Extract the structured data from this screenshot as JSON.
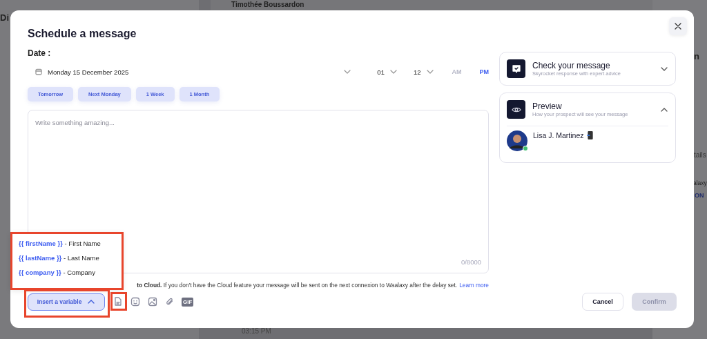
{
  "backdrop": {
    "texts": [
      {
        "kind": "heading",
        "text": "Di"
      },
      {
        "kind": "contact",
        "text": "Timothée Boussardon"
      },
      {
        "kind": "side-name",
        "text": "n"
      },
      {
        "kind": "details",
        "text": "tails"
      },
      {
        "kind": "brand",
        "text": "alaxy"
      },
      {
        "kind": "badge",
        "text": "ON"
      },
      {
        "kind": "time",
        "text": "03:15 PM"
      }
    ]
  },
  "modal": {
    "title": "Schedule a message",
    "date_label": "Date :",
    "date": {
      "value": "Monday 15 December 2025",
      "hour": "01",
      "minute": "12",
      "periods": [
        {
          "label": "AM",
          "selected": false
        },
        {
          "label": "PM",
          "selected": true
        }
      ]
    },
    "quick_dates": [
      "Tomorrow",
      "Next Monday",
      "1 Week",
      "1 Month"
    ],
    "message": {
      "placeholder": "Write something amazing...",
      "counter": "0/8000"
    },
    "notice": {
      "text": "**to Cloud.** If you don't have the Cloud feature your message will be sent on the next connexion to Waalaxy after the delay set.",
      "link": "Learn more"
    },
    "variable_menu": {
      "open": true,
      "items": [
        {
          "variable": "{{ firstName }}",
          "label": "- First Name"
        },
        {
          "variable": "{{ lastName }}",
          "label": "- Last Name"
        },
        {
          "variable": "{{ company }}",
          "label": "- Company"
        }
      ]
    },
    "insert_button": {
      "label": "Insert a variable",
      "expanded": true
    },
    "toolbar": [
      {
        "kind": "template"
      },
      {
        "kind": "emoji"
      },
      {
        "kind": "image"
      },
      {
        "kind": "attachment"
      },
      {
        "kind": "gif",
        "label": "GIF"
      }
    ],
    "cancel": "Cancel",
    "confirm": {
      "label": "Confirm",
      "disabled": true
    },
    "panels": [
      {
        "kind": "check",
        "title": "Check your message",
        "subtitle": "Skyrocket response with expert advice",
        "expanded": false
      },
      {
        "kind": "preview",
        "title": "Preview",
        "subtitle": "How your prospect will see your message",
        "expanded": true,
        "prospect": {
          "name": "Lisa J. Martinez",
          "online": true
        }
      }
    ]
  },
  "highlights": [
    {
      "kind": "menu"
    },
    {
      "kind": "insert-button"
    },
    {
      "kind": "template-icon"
    }
  ]
}
